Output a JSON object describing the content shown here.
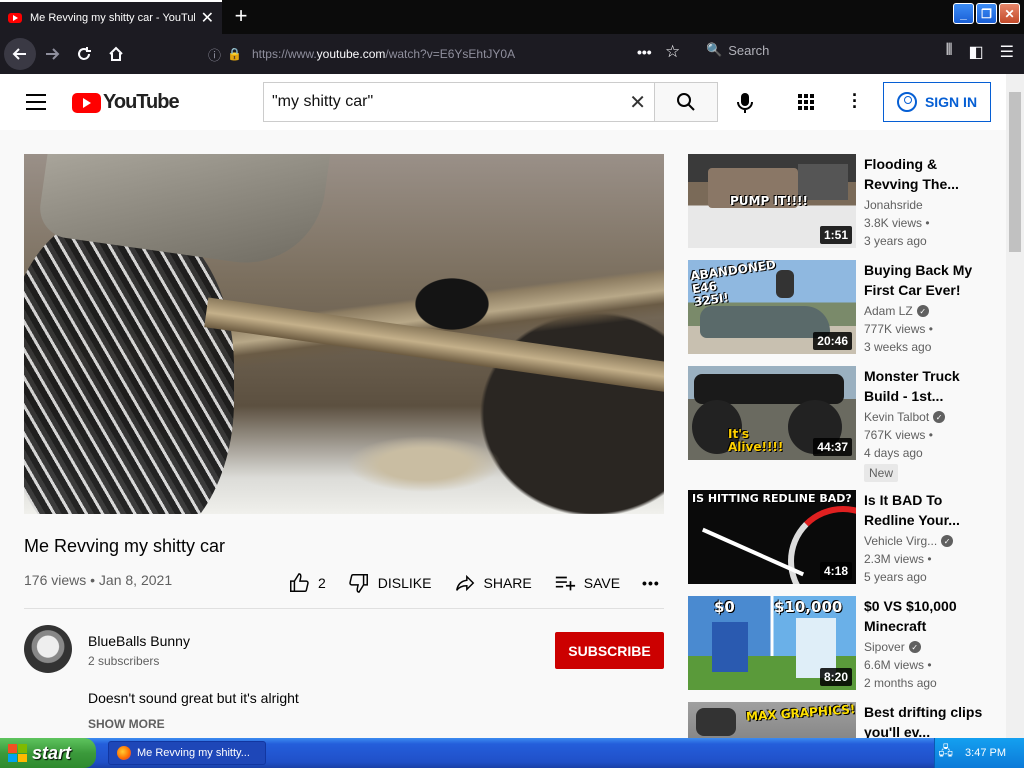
{
  "browser": {
    "tab_title": "Me Revving my shitty car - YouTube",
    "url_prefix": "https://www.",
    "url_host": "youtube.com",
    "url_path": "/watch?v=E6YsEhtJY0A",
    "search_placeholder": "Search",
    "icons": [
      "back-arrow-icon",
      "forward-arrow-icon",
      "reload-icon",
      "home-icon",
      "info-icon",
      "lock-icon",
      "more-dots-icon",
      "star-icon",
      "library-icon",
      "sidebar-icon",
      "menu-icon"
    ]
  },
  "masthead": {
    "logo_text": "YouTube",
    "search_query": "\"my shitty car\"",
    "signin_label": "SIGN IN"
  },
  "video": {
    "title": "Me Revving my shitty car",
    "meta": "176 views • Jan 8, 2021",
    "likes": "2",
    "dislike_label": "DISLIKE",
    "share_label": "SHARE",
    "save_label": "SAVE",
    "more_label": "•••"
  },
  "channel": {
    "name": "BlueBalls Bunny",
    "subscribers": "2 subscribers",
    "subscribe_label": "SUBSCRIBE",
    "description": "Doesn't sound great but it's alright",
    "show_more": "SHOW MORE"
  },
  "recommendations": [
    {
      "title": "Flooding & Revving The...",
      "channel": "Jonahsride",
      "verified": false,
      "views": "3.8K views •",
      "age": "3 years ago",
      "duration": "1:51",
      "thumb_text": "PUMP IT!!!!"
    },
    {
      "title": "Buying Back My First Car Ever!",
      "channel": "Adam LZ",
      "verified": true,
      "views": "777K views •",
      "age": "3 weeks ago",
      "duration": "20:46",
      "thumb_text": "ABANDONED E46 325I!"
    },
    {
      "title": "Monster Truck Build - 1st...",
      "channel": "Kevin Talbot",
      "verified": true,
      "views": "767K views •",
      "age": "4 days ago",
      "duration": "44:37",
      "thumb_text": "It's Alive!!!!",
      "badge": "New"
    },
    {
      "title": "Is It BAD To Redline Your...",
      "channel": "Vehicle Virg...",
      "verified": true,
      "views": "2.3M views •",
      "age": "5 years ago",
      "duration": "4:18",
      "thumb_text": "IS HITTING REDLINE BAD?"
    },
    {
      "title": "$0 VS $10,000 Minecraft",
      "channel": "Sipover",
      "verified": true,
      "views": "6.6M views •",
      "age": "2 months ago",
      "duration": "8:20",
      "thumb_text_left": "$0",
      "thumb_text_right": "$10,000"
    },
    {
      "title": "Best drifting clips you'll ev...",
      "thumb_text": "MAX GRAPHICS!"
    }
  ],
  "taskbar": {
    "start_label": "start",
    "task_label": "Me Revving my shitty...",
    "clock": "3:47 PM"
  }
}
